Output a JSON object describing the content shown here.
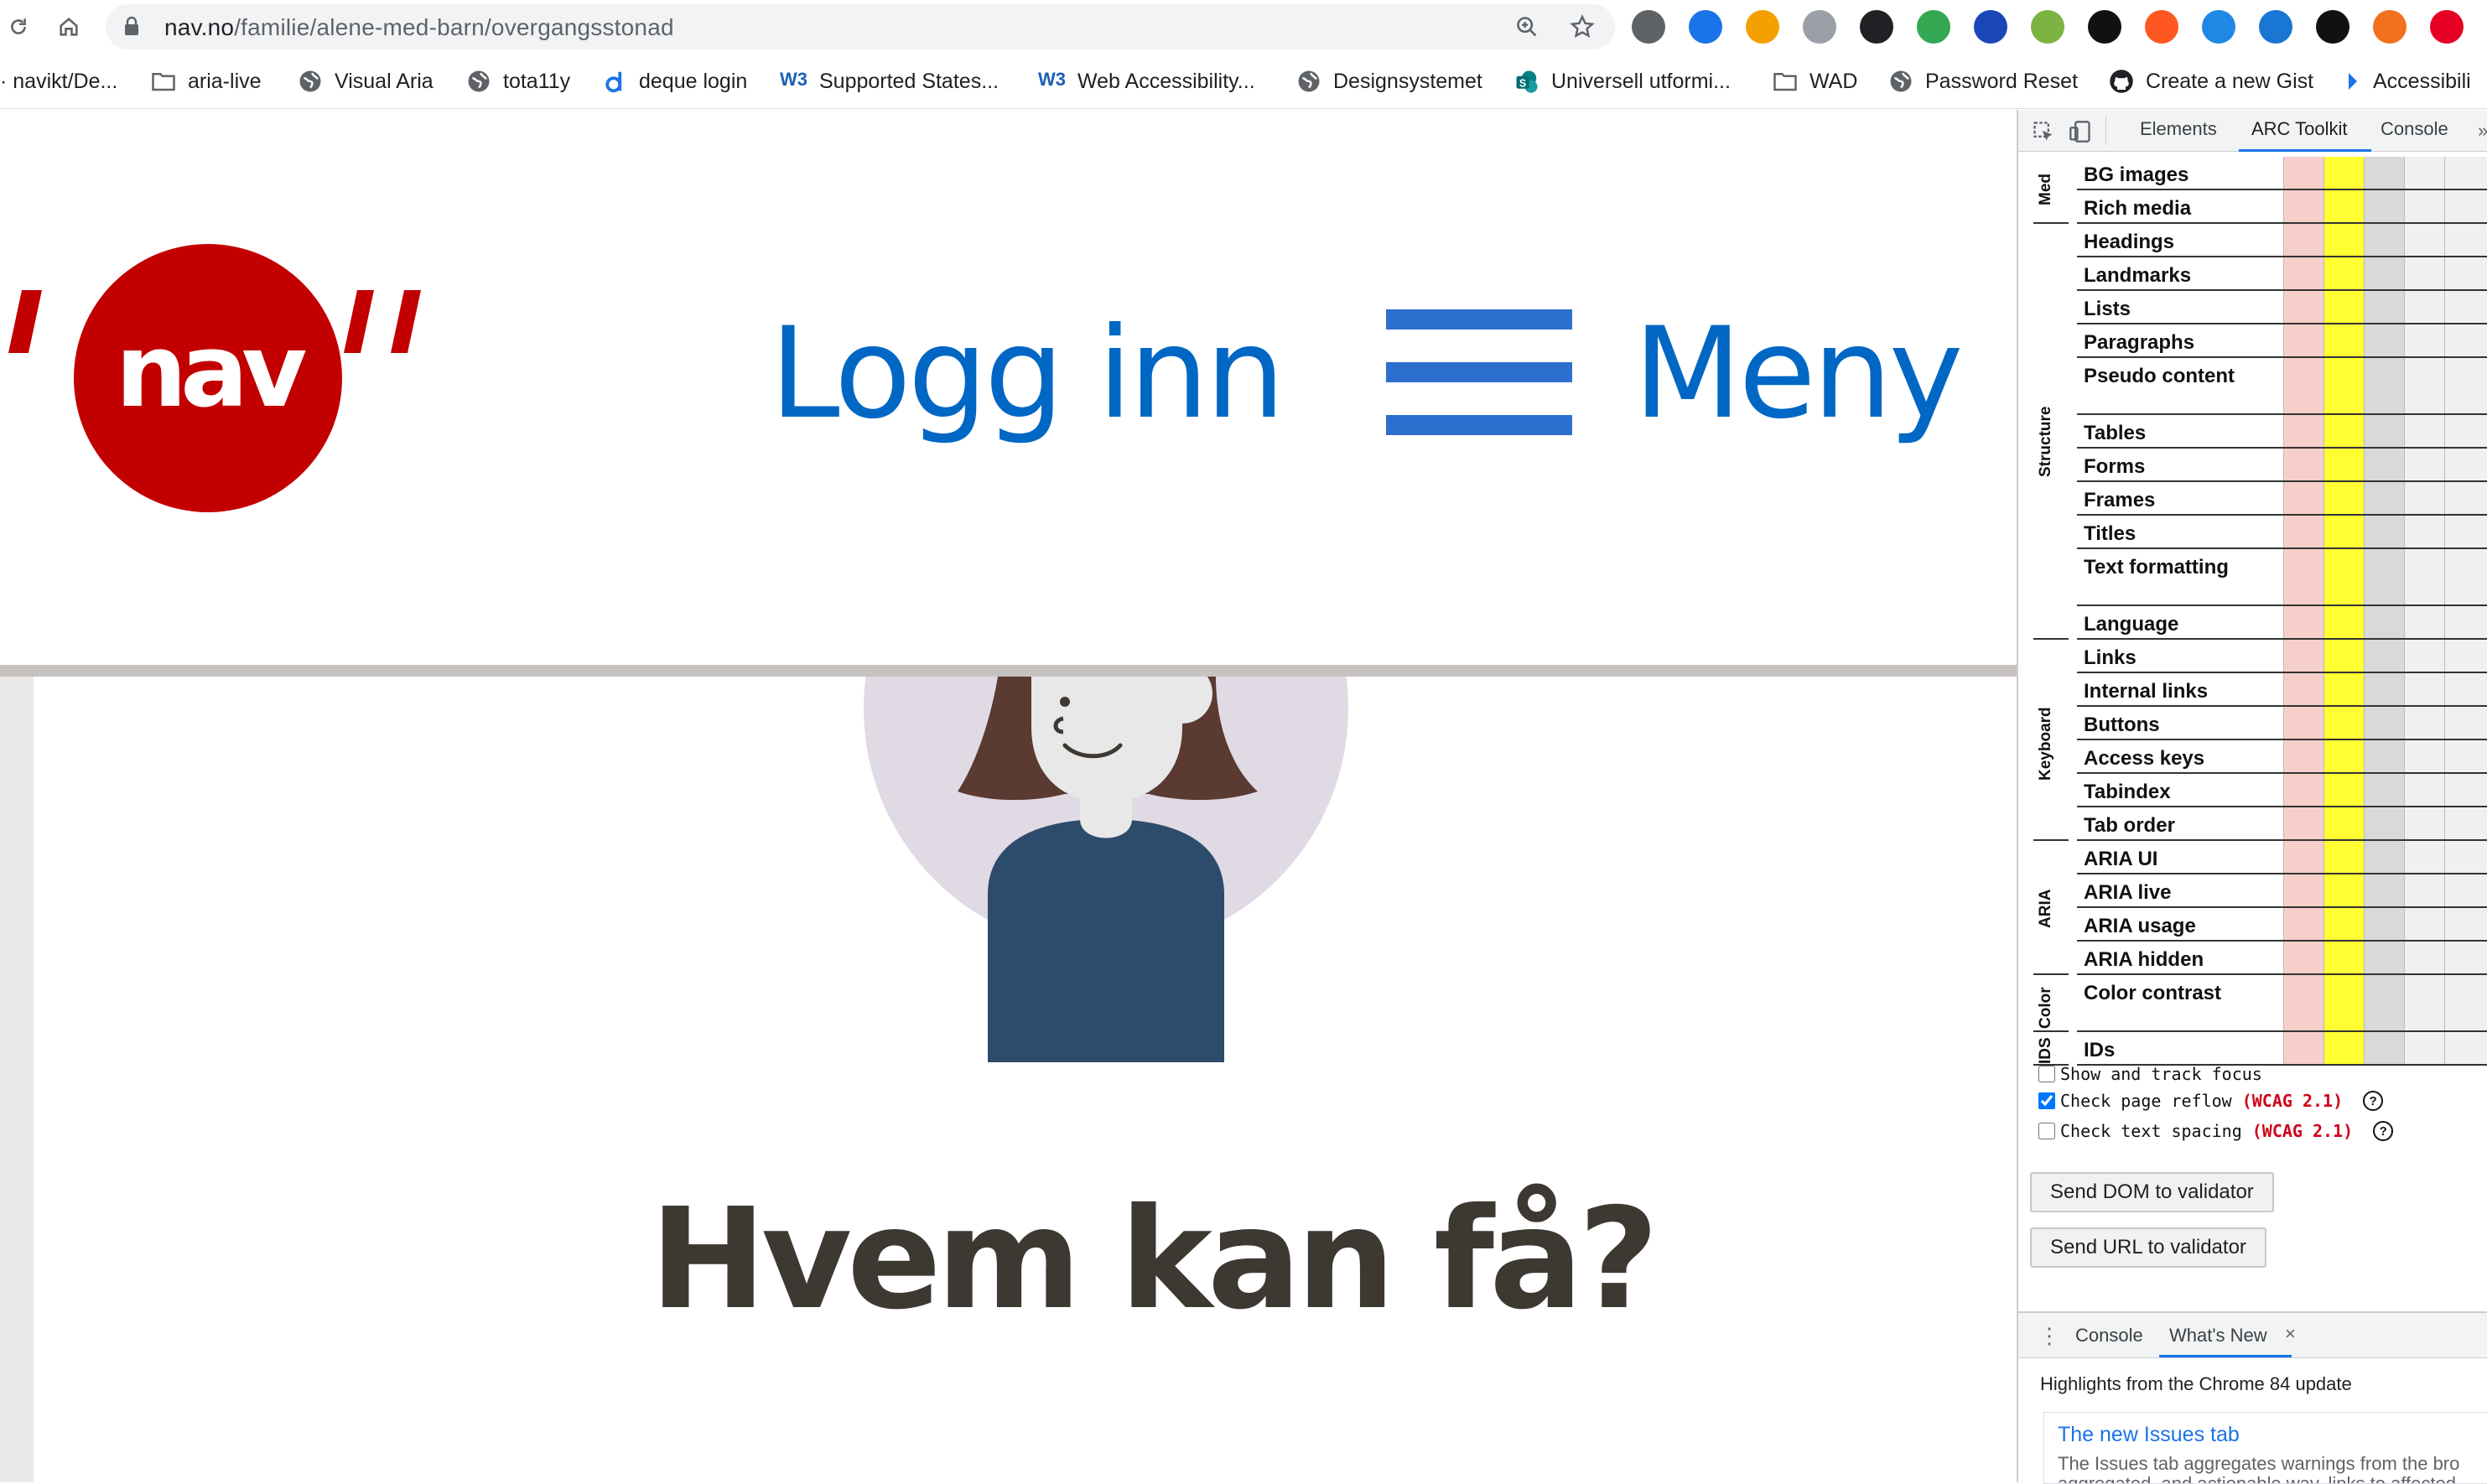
{
  "browser": {
    "url_host": "nav.no",
    "url_path": "/familie/alene-med-barn/overgangsstonad",
    "nav_icons": [
      "reload-icon",
      "home-icon"
    ],
    "omnibox_icons": [
      "zoom-icon",
      "bookmark-star-icon"
    ],
    "extension_colors": [
      "#5f6368",
      "#1a73e8",
      "#f4a000",
      "#9aa0a6",
      "#202124",
      "#34a853",
      "#1a47b8",
      "#7cb342",
      "#111111",
      "#ff5722",
      "#1e88e5",
      "#1976d2",
      "#111111",
      "#f2711c",
      "#e60023",
      "#ea4335"
    ]
  },
  "bookmarks": [
    {
      "label": "· navikt/De...",
      "icon": "github-icon"
    },
    {
      "label": "aria-live",
      "icon": "folder-icon"
    },
    {
      "label": "Visual Aria",
      "icon": "globe-icon"
    },
    {
      "label": "tota11y",
      "icon": "globe-icon"
    },
    {
      "label": "deque login",
      "icon": "deque-icon"
    },
    {
      "label": "Supported States...",
      "icon": "w3c-icon"
    },
    {
      "label": "Web Accessibility...",
      "icon": "w3c-icon"
    },
    {
      "label": "Designsystemet",
      "icon": "globe-icon"
    },
    {
      "label": "Universell utformi...",
      "icon": "sharepoint-icon"
    },
    {
      "label": "WAD",
      "icon": "folder-icon"
    },
    {
      "label": "Password Reset",
      "icon": "globe-icon"
    },
    {
      "label": "Create a new Gist",
      "icon": "github-icon"
    },
    {
      "label": "Accessibili",
      "icon": "a11y-icon"
    }
  ],
  "site": {
    "logo_text": "nav",
    "login_label": "Logg inn",
    "menu_label": "Meny",
    "heading": "Hvem kan få?",
    "brand_red": "#c30000",
    "link_blue": "#0067c5"
  },
  "devtools": {
    "tabs": [
      "Elements",
      "ARC Toolkit",
      "Console"
    ],
    "active_tab": "ARC Toolkit",
    "groups": [
      {
        "name": "Med",
        "items": [
          "BG images",
          "Rich media"
        ]
      },
      {
        "name": "Structure",
        "items": [
          "Headings",
          "Landmarks",
          "Lists",
          "Paragraphs",
          "Pseudo content",
          "Tables",
          "Forms",
          "Frames",
          "Titles",
          "Text formatting",
          "Language"
        ]
      },
      {
        "name": "Keyboard",
        "items": [
          "Links",
          "Internal links",
          "Buttons",
          "Access keys",
          "Tabindex",
          "Tab order"
        ]
      },
      {
        "name": "ARIA",
        "items": [
          "ARIA UI",
          "ARIA live",
          "ARIA usage",
          "ARIA hidden"
        ]
      },
      {
        "name": "Color",
        "items": [
          "Color contrast"
        ]
      },
      {
        "name": "IDS",
        "items": [
          "IDs"
        ]
      }
    ],
    "options": [
      {
        "label": "Show and track focus",
        "checked": false,
        "wcag": ""
      },
      {
        "label": "Check page reflow",
        "checked": true,
        "wcag": "(WCAG 2.1)"
      },
      {
        "label": "Check text spacing",
        "checked": false,
        "wcag": "(WCAG 2.1)"
      }
    ],
    "help_glyph": "?",
    "send_dom_label": "Send DOM to validator",
    "send_url_label": "Send URL to validator",
    "drawer": {
      "tabs": [
        "Console",
        "What's New"
      ],
      "active_tab": "What's New",
      "close_glyph": "×",
      "highlights": "Highlights from the Chrome 84 update",
      "card_title": "The new Issues tab",
      "card_text": "The Issues tab aggregates warnings from the bro",
      "card_text2": "aggregated, and actionable way, links to affected"
    }
  }
}
